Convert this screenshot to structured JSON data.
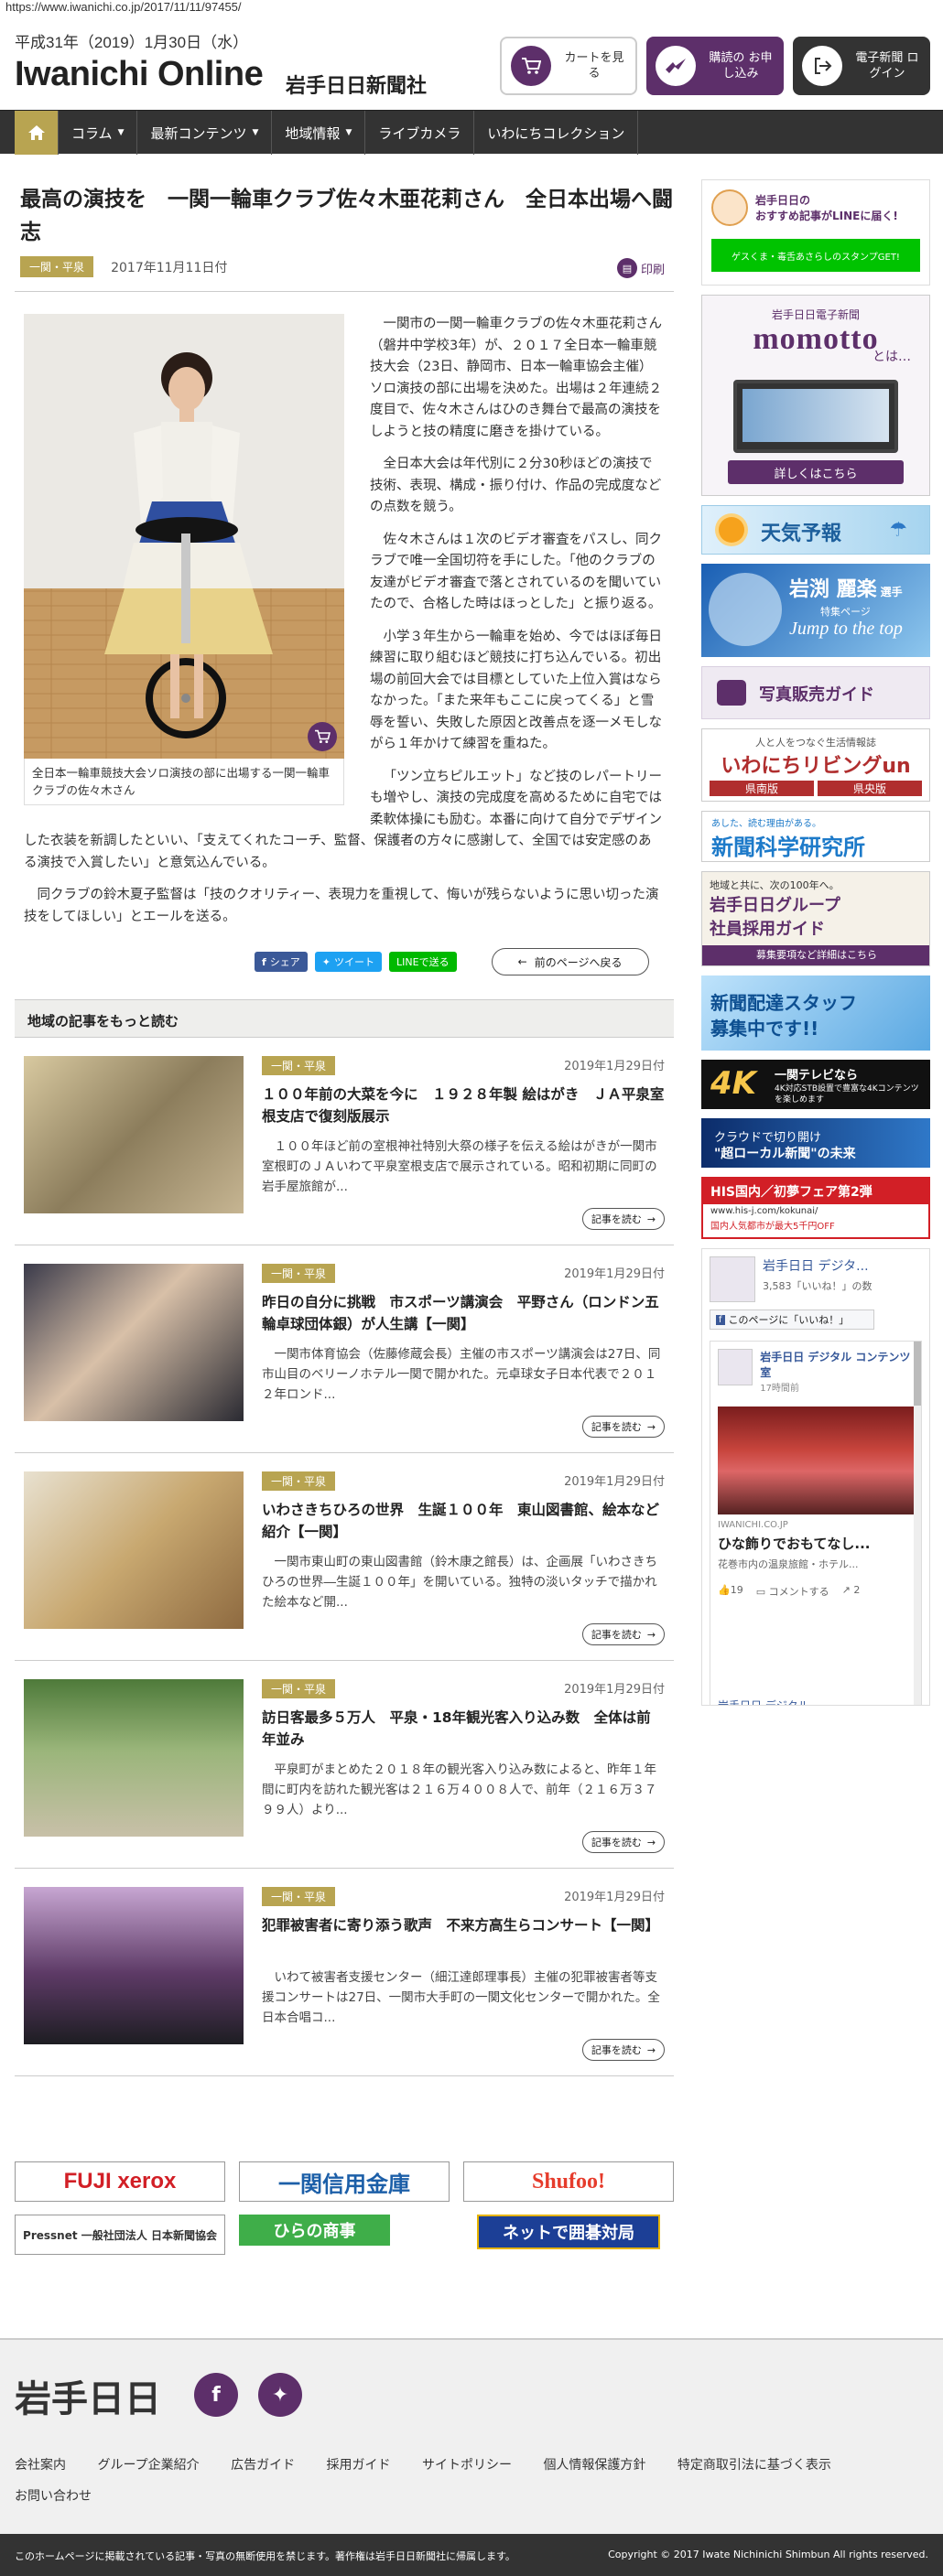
{
  "url": "https://www.iwanichi.co.jp/2017/11/11/97455/",
  "header": {
    "date": "平成31年（2019）1月30日（水）",
    "logo": "Iwanichi Online",
    "logo_sub": "岩手日日新聞社",
    "cart": "カートを見る",
    "subscribe": "購読の お申し込み",
    "epaper": "電子新聞 ログイン"
  },
  "nav": {
    "home_icon": "home-icon",
    "items": [
      "コラム",
      "最新コンテンツ",
      "地域情報",
      "ライブカメラ",
      "いわにちコレクション"
    ]
  },
  "article": {
    "title": "最高の演技を　一関一輪車クラブ佐々木亜花莉さん　全日本出場へ闘志",
    "tag": "一関・平泉",
    "date": "2017年11月11日付",
    "print": "印刷",
    "caption": "全日本一輪車競技大会ソロ演技の部に出場する一関一輪車クラブの佐々木さん",
    "paragraphs": [
      "一関市の一関一輪車クラブの佐々木亜花莉さん（磐井中学校3年）が、２０１７全日本一輪車競技大会（23日、静岡市、日本一輪車協会主催）ソロ演技の部に出場を決めた。出場は２年連続２度目で、佐々木さんはひのき舞台で最高の演技をしようと技の精度に磨きを掛けている。",
      "全日本大会は年代別に２分30秒ほどの演技で技術、表現、構成・振り付け、作品の完成度などの点数を競う。",
      "佐々木さんは１次のビデオ審査をパスし、同クラブで唯一全国切符を手にした。「他のクラブの友達がビデオ審査で落とされているのを聞いていたので、合格した時はほっとした」と振り返る。",
      "小学３年生から一輪車を始め、今ではほぼ毎日練習に取り組むほど競技に打ち込んでいる。初出場の前回大会では目標としていた上位入賞はならなかった。「また来年もここに戻ってくる」と雪辱を誓い、失敗した原因と改善点を逐一メモしながら１年かけて練習を重ねた。",
      "「ツン立ちピルエット」など技のレパートリーも増やし、演技の完成度を高めるために自宅では柔軟体操にも励む。本番に向けて自分でデザインした衣装を新調したといい、「支えてくれたコーチ、監督、保護者の方々に感謝して、全国では安定感のある演技で入賞したい」と意気込んでいる。",
      "同クラブの鈴木夏子監督は「技のクオリティー、表現力を重視して、悔いが残らないように思い切った演技をしてほしい」とエールを送る。"
    ],
    "share": {
      "fb": "シェア",
      "tw": "ツイート",
      "line": "LINEで送る",
      "prev": "前のページへ戻る"
    }
  },
  "related": {
    "heading": "地域の記事をもっと読む",
    "more": "記事を読む",
    "items": [
      {
        "tag": "一関・平泉",
        "date": "2019年1月29日付",
        "title": "１００年前の大菜を今に　１９２８年製 絵はがき　ＪＡ平泉室根支店で復刻版展示",
        "excerpt": "１００年ほど前の室根神社特別大祭の様子を伝える絵はがきが一関市室根町のＪＡいわて平泉室根支店で展示されている。昭和初期に同町の岩手屋旅館が..."
      },
      {
        "tag": "一関・平泉",
        "date": "2019年1月29日付",
        "title": "昨日の自分に挑戦　市スポーツ講演会　平野さん（ロンドン五輪卓球団体銀）が人生講【一関】",
        "excerpt": "一関市体育協会（佐藤修蔵会長）主催の市スポーツ講演会は27日、同市山目のベリーノホテル一関で開かれた。元卓球女子日本代表で２０１２年ロンド..."
      },
      {
        "tag": "一関・平泉",
        "date": "2019年1月29日付",
        "title": "いわさきちひろの世界　生誕１００年　東山図書館、絵本など紹介【一関】",
        "excerpt": "一関市東山町の東山図書館（鈴木康之館長）は、企画展「いわさきちひろの世界―生誕１００年」を開いている。独特の淡いタッチで描かれた絵本など開..."
      },
      {
        "tag": "一関・平泉",
        "date": "2019年1月29日付",
        "title": "訪日客最多５万人　平泉・18年観光客入り込み数　全体は前年並み",
        "excerpt": "平泉町がまとめた２０１８年の観光客入り込み数によると、昨年１年間に町内を訪れた観光客は２１６万４００８人で、前年（２１６万３７９９人）より..."
      },
      {
        "tag": "一関・平泉",
        "date": "2019年1月29日付",
        "title": "犯罪被害者に寄り添う歌声　不来方高生らコンサート【一関】",
        "excerpt": "いわて被害者支援センター（細江達郎理事長）主催の犯罪被害者等支援コンサートは27日、一関市大手町の一関文化センターで開かれた。全日本合唱コ..."
      }
    ]
  },
  "side": {
    "line": {
      "t1": "岩手日日の",
      "t2": "おすすめ記事がLINEに届く!",
      "btn": "ゲスくま・毒舌あさらしのスタンプGET!"
    },
    "momotto": {
      "t1": "岩手日日電子新聞",
      "t2": "momotto",
      "t3": "とは…",
      "btn": "詳しくはこちら"
    },
    "weather": "天気予報",
    "iwabuchi": {
      "name": "岩渕 麗楽",
      "role": "選手",
      "sub": "特集ページ",
      "jump": "Jump to the top"
    },
    "photo": "写真販売ガイド",
    "living": {
      "t1": "人と人をつなぐ生活情報誌",
      "t2": "いわにちリビングun",
      "a": "県南版",
      "b": "県央版"
    },
    "science": {
      "t1": "あした、読む理由がある。",
      "t2": "新聞科学研究所"
    },
    "recruit": {
      "t1": "地域と共に、次の100年へ。",
      "t2": "岩手日日グループ",
      "t3": "社員採用ガイド",
      "t4": "募集要項など詳細はこちら"
    },
    "staff": {
      "t1": "新聞配達スタッフ",
      "t2": "募集中です!!"
    },
    "k4": {
      "t1": "4K",
      "t2": "一関テレビなら",
      "t3": "4K対応STB設置で豊富な4Kコンテンツを楽しめます"
    },
    "cloud": {
      "t1": "クラウドで切り開け",
      "t2": "\"超ローカル新聞\"の未来"
    },
    "his": {
      "t1": "HIS国内／初夢フェア第2弾",
      "t2": "www.his-j.com/kokunai/",
      "t3": "国内人気都市が最大5千円OFF"
    },
    "fb": {
      "page": "岩手日日 デジタ...",
      "likes": "3,583「いいね！」の数",
      "like_btn": "このページに「いいね！」",
      "post_name": "岩手日日 デジタル コンテンツ室",
      "post_time": "17時間前",
      "domain": "IWANICHI.CO.JP",
      "post_title": "ひな飾りでおもてなし...",
      "post_sub": "花巻市内の温泉旅館・ホテル...",
      "reactions": "19",
      "comment": "コメントする",
      "share": "2",
      "next": "岩手日日 デジタル"
    }
  },
  "sponsors": [
    "FUJI xerox",
    "一関信用金庫",
    "Shufoo!",
    "Pressnet 一般社団法人 日本新聞協会",
    "ひらの商事",
    "ネットで囲碁対局"
  ],
  "footer": {
    "logo": "岩手日日",
    "links": [
      "会社案内",
      "グループ企業紹介",
      "広告ガイド",
      "採用ガイド",
      "サイトポリシー",
      "個人情報保護方針",
      "特定商取引法に基づく表示",
      "お問い合わせ"
    ],
    "notice": "このホームページに掲載されている記事・写真の無断使用を禁じます。著作権は岩手日日新聞社に帰属します。",
    "copyright": "Copyright © 2017 Iwate Nichinichi Shimbun All rights reserved."
  }
}
